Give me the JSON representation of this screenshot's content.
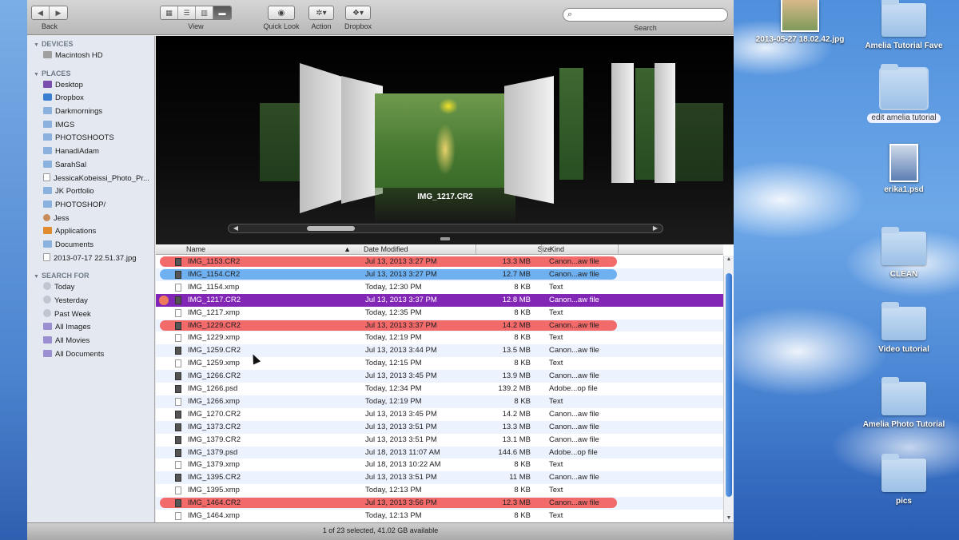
{
  "toolbar": {
    "back_label": "Back",
    "view_label": "View",
    "quicklook_label": "Quick Look",
    "action_label": "Action",
    "dropbox_label": "Dropbox",
    "search_label": "Search",
    "search_placeholder": ""
  },
  "sidebar": {
    "devices_header": "DEVICES",
    "places_header": "PLACES",
    "search_header": "SEARCH FOR",
    "devices": [
      "Macintosh HD"
    ],
    "places": [
      "Desktop",
      "Dropbox",
      "Darkmornings",
      "IMGS",
      "PHOTOSHOOTS",
      "HanadiAdam",
      "SarahSal",
      "JessicaKobeissi_Photo_Pr...",
      "JK Portfolio",
      "PHOTOSHOP/",
      "Jess",
      "Applications",
      "Documents",
      "2013-07-17 22.51.37.jpg"
    ],
    "search_for": [
      "Today",
      "Yesterday",
      "Past Week",
      "All Images",
      "All Movies",
      "All Documents"
    ]
  },
  "coverflow": {
    "title": "IMG_1217.CR2"
  },
  "list": {
    "columns": {
      "name": "Name",
      "date": "Date Modified",
      "size": "Size",
      "kind": "Kind"
    },
    "rows": [
      {
        "name": "IMG_1153.CR2",
        "date": "Jul 13, 2013 3:27 PM",
        "size": "13.3 MB",
        "kind": "Canon...aw file",
        "label": "#f36a6a"
      },
      {
        "name": "IMG_1154.CR2",
        "date": "Jul 13, 2013 3:27 PM",
        "size": "12.7 MB",
        "kind": "Canon...aw file",
        "label": "#6fb1f0"
      },
      {
        "name": "IMG_1154.xmp",
        "date": "Today, 12:30 PM",
        "size": "8 KB",
        "kind": "Text",
        "label": ""
      },
      {
        "name": "IMG_1217.CR2",
        "date": "Jul 13, 2013 3:37 PM",
        "size": "12.8 MB",
        "kind": "Canon...aw file",
        "label": "selected"
      },
      {
        "name": "IMG_1217.xmp",
        "date": "Today, 12:35 PM",
        "size": "8 KB",
        "kind": "Text",
        "label": ""
      },
      {
        "name": "IMG_1229.CR2",
        "date": "Jul 13, 2013 3:37 PM",
        "size": "14.2 MB",
        "kind": "Canon...aw file",
        "label": "#f36a6a"
      },
      {
        "name": "IMG_1229.xmp",
        "date": "Today, 12:19 PM",
        "size": "8 KB",
        "kind": "Text",
        "label": ""
      },
      {
        "name": "IMG_1259.CR2",
        "date": "Jul 13, 2013 3:44 PM",
        "size": "13.5 MB",
        "kind": "Canon...aw file",
        "label": ""
      },
      {
        "name": "IMG_1259.xmp",
        "date": "Today, 12:15 PM",
        "size": "8 KB",
        "kind": "Text",
        "label": ""
      },
      {
        "name": "IMG_1266.CR2",
        "date": "Jul 13, 2013 3:45 PM",
        "size": "13.9 MB",
        "kind": "Canon...aw file",
        "label": ""
      },
      {
        "name": "IMG_1266.psd",
        "date": "Today, 12:34 PM",
        "size": "139.2 MB",
        "kind": "Adobe...op file",
        "label": ""
      },
      {
        "name": "IMG_1266.xmp",
        "date": "Today, 12:19 PM",
        "size": "8 KB",
        "kind": "Text",
        "label": ""
      },
      {
        "name": "IMG_1270.CR2",
        "date": "Jul 13, 2013 3:45 PM",
        "size": "14.2 MB",
        "kind": "Canon...aw file",
        "label": ""
      },
      {
        "name": "IMG_1373.CR2",
        "date": "Jul 13, 2013 3:51 PM",
        "size": "13.3 MB",
        "kind": "Canon...aw file",
        "label": ""
      },
      {
        "name": "IMG_1379.CR2",
        "date": "Jul 13, 2013 3:51 PM",
        "size": "13.1 MB",
        "kind": "Canon...aw file",
        "label": ""
      },
      {
        "name": "IMG_1379.psd",
        "date": "Jul 18, 2013 11:07 AM",
        "size": "144.6 MB",
        "kind": "Adobe...op file",
        "label": ""
      },
      {
        "name": "IMG_1379.xmp",
        "date": "Jul 18, 2013 10:22 AM",
        "size": "8 KB",
        "kind": "Text",
        "label": ""
      },
      {
        "name": "IMG_1395.CR2",
        "date": "Jul 13, 2013 3:51 PM",
        "size": "11 MB",
        "kind": "Canon...aw file",
        "label": ""
      },
      {
        "name": "IMG_1395.xmp",
        "date": "Today, 12:13 PM",
        "size": "8 KB",
        "kind": "Text",
        "label": ""
      },
      {
        "name": "IMG_1464.CR2",
        "date": "Jul 13, 2013 3:56 PM",
        "size": "12.3 MB",
        "kind": "Canon...aw file",
        "label": "#f36a6a"
      },
      {
        "name": "IMG_1464.xmp",
        "date": "Today, 12:13 PM",
        "size": "8 KB",
        "kind": "Text",
        "label": ""
      }
    ]
  },
  "status": "1 of 23 selected, 41.02 GB available",
  "desktop": {
    "items": [
      {
        "label": "2013-05-27 18.02.42.jpg",
        "type": "thumb"
      },
      {
        "label": "Amelia Tutorial Fave",
        "type": "folder"
      },
      {
        "label": "edit amelia tutorial",
        "type": "folder-selected"
      },
      {
        "label": "erika1.psd",
        "type": "thumb"
      },
      {
        "label": "CLEAN",
        "type": "folder"
      },
      {
        "label": "Video tutorial",
        "type": "folder"
      },
      {
        "label": "Amelia Photo Tutorial",
        "type": "folder"
      },
      {
        "label": "pics",
        "type": "folder"
      }
    ]
  }
}
